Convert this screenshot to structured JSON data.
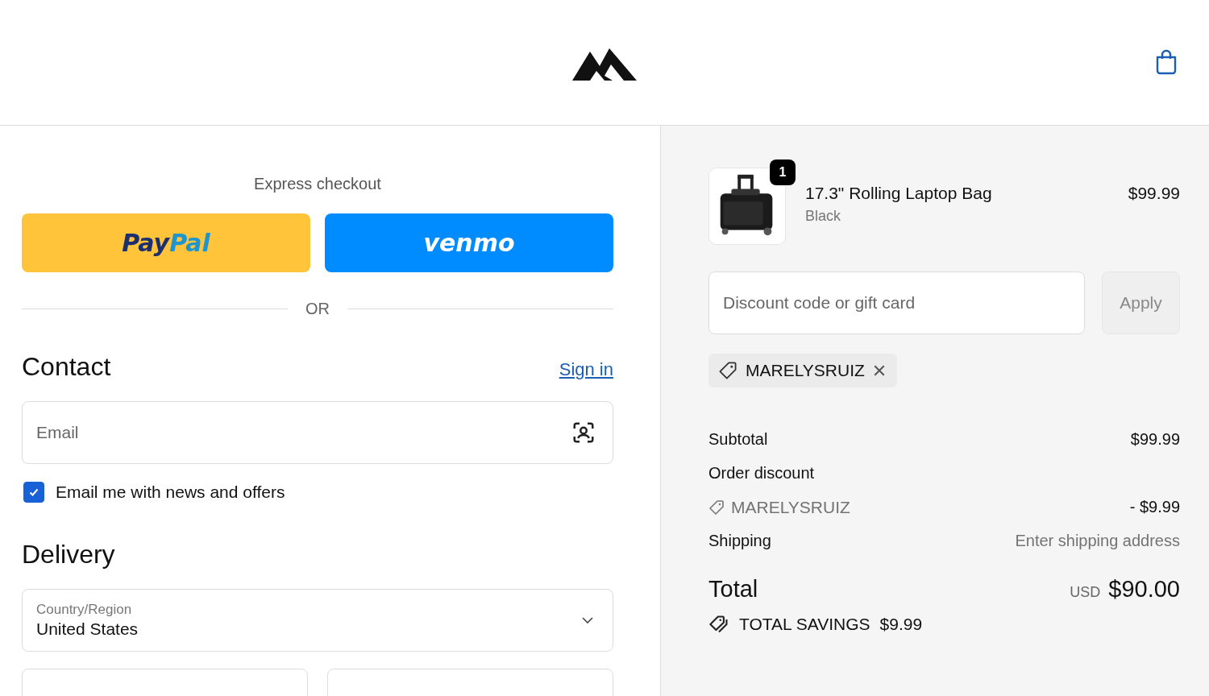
{
  "express": {
    "title": "Express checkout",
    "buttons": [
      {
        "kind": "paypal",
        "parts": [
          "Pay",
          "Pal"
        ]
      },
      {
        "kind": "venmo",
        "parts": [
          "venmo"
        ]
      }
    ],
    "divider": "OR"
  },
  "contact": {
    "heading": "Contact",
    "sign_in": "Sign in",
    "email": {
      "placeholder": "Email"
    },
    "newsletter": {
      "label": "Email me with news and offers",
      "checked": true
    }
  },
  "delivery": {
    "heading": "Delivery",
    "country": {
      "label": "Country/Region",
      "value": "United States"
    }
  },
  "order": {
    "item": {
      "quantity": "1",
      "name": "17.3\" Rolling Laptop Bag",
      "variant": "Black",
      "price": "$99.99"
    },
    "discount": {
      "placeholder": "Discount code or gift card",
      "button": "Apply",
      "disabled": true
    },
    "applied_code": "MARELYSRUIZ",
    "subtotal": {
      "label": "Subtotal",
      "value": "$99.99"
    },
    "order_discount": {
      "label": "Order discount",
      "code": "MARELYSRUIZ",
      "value": "- $9.99"
    },
    "shipping": {
      "label": "Shipping",
      "value": "Enter shipping address"
    },
    "total": {
      "label": "Total",
      "currency": "USD",
      "value": "$90.00"
    },
    "savings": {
      "label": "TOTAL SAVINGS",
      "value": "$9.99"
    }
  }
}
